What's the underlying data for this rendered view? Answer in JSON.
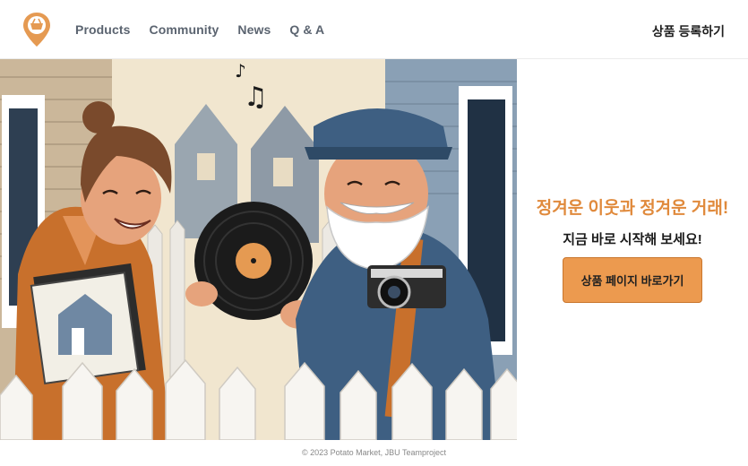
{
  "header": {
    "logo_icon": "basket-pin-icon",
    "nav": [
      {
        "label": "Products"
      },
      {
        "label": "Community"
      },
      {
        "label": "News"
      },
      {
        "label": "Q & A"
      }
    ],
    "register_label": "상품 등록하기"
  },
  "hero": {
    "image": "illustration-neighbors-trading-vinyl-record"
  },
  "promo": {
    "headline": "정겨운 이웃과 정겨운 거래!",
    "subline": "지금 바로 시작해 보세요!",
    "cta_label": "상품 페이지 바로가기"
  },
  "footer": {
    "text": "© 2023 Potato Market, JBU Teamproject"
  },
  "colors": {
    "accent": "#e08a3c",
    "button": "#ec9a4f",
    "nav_text": "#5b6470"
  }
}
